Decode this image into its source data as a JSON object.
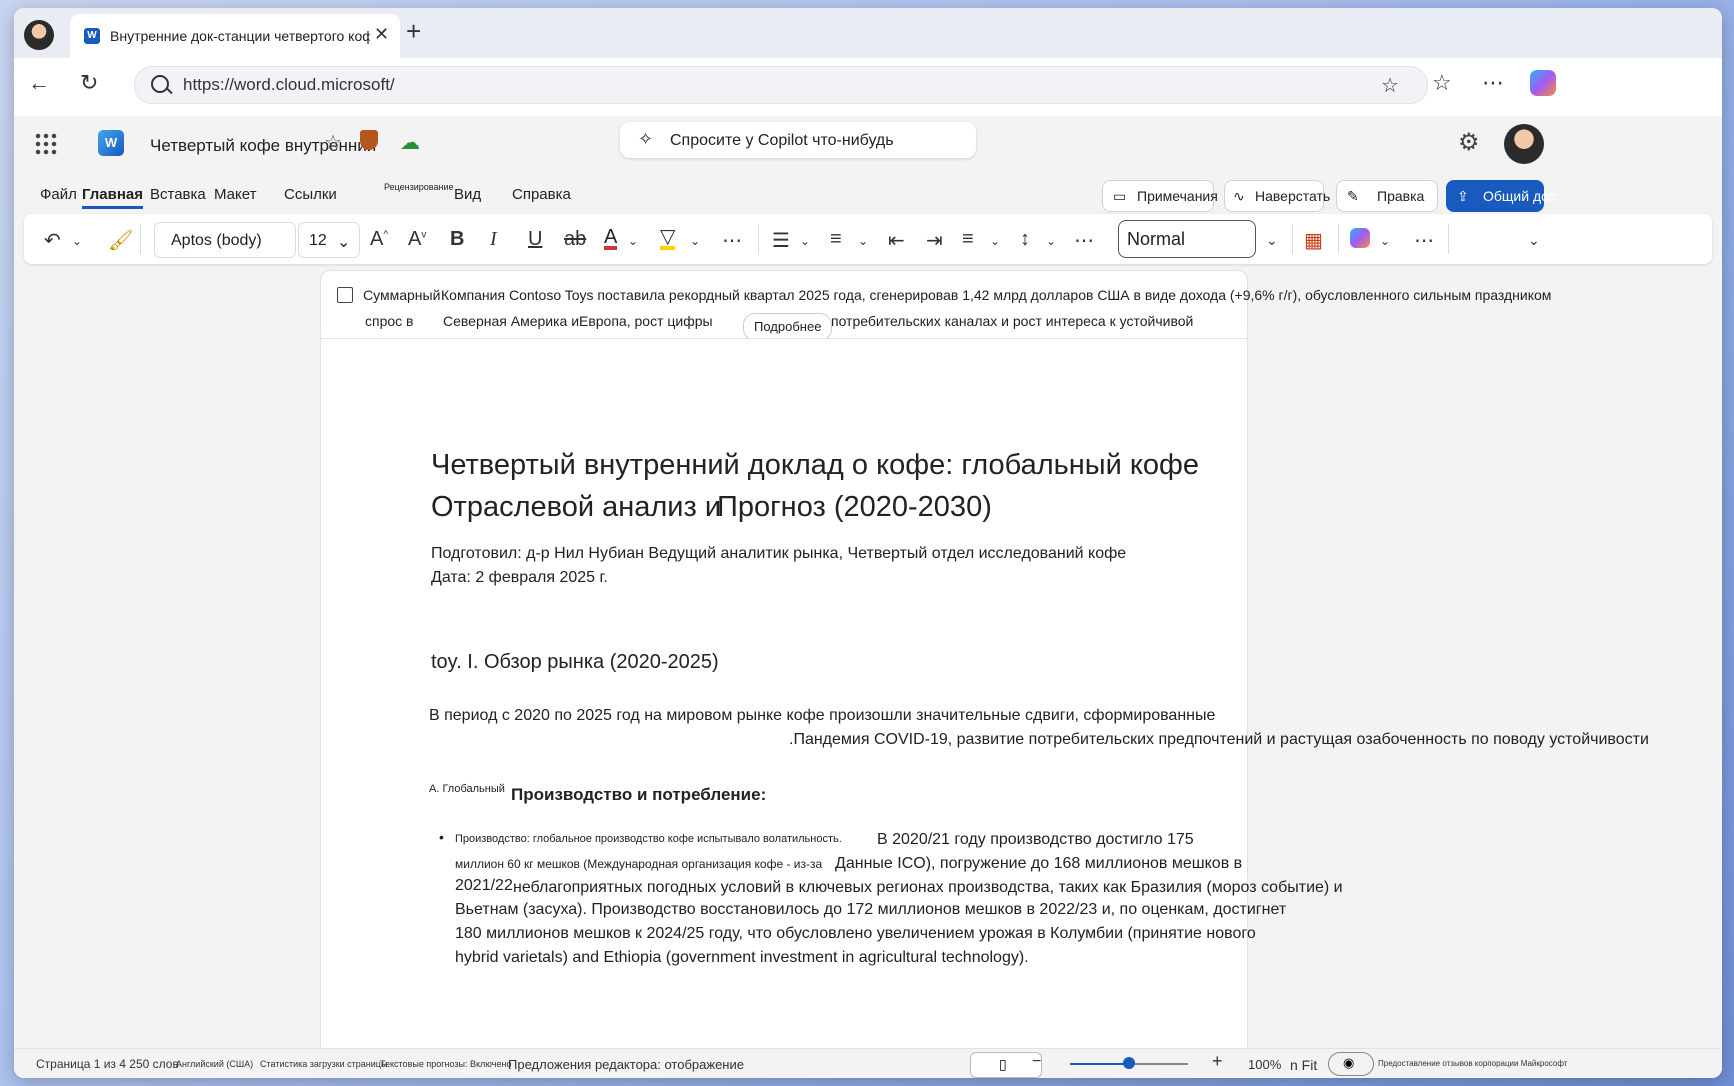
{
  "browser": {
    "tab_title": "Внутренние док-станции четвертого кофе",
    "url": "https://word.cloud.microsoft/"
  },
  "app": {
    "doc_title": "Четвертый кофе внутренний",
    "copilot_placeholder": "Спросите у Copilot что-нибудь"
  },
  "menu": {
    "items": [
      "Файл",
      "Главная",
      "Вставка",
      "Макет",
      "Ссылки",
      "Рецензирование",
      "Вид",
      "Справка"
    ],
    "active": "Главная",
    "comments": "Примечания",
    "catchup": "Наверстать",
    "editing": "Правка",
    "share": "Общий дос"
  },
  "ribbon": {
    "font": "Aptos (body)",
    "size": "12",
    "style": "Normal"
  },
  "summary": {
    "label": "Суммарный",
    "line1": "Компания Contoso Toys поставила рекордный квартал 2025 года, сгенерировав 1,42 млрд долларов США в виде дохода (+9,6% г/г), обусловленного сильным праздником",
    "line2_a": "спрос в",
    "line2_b": "Северная Америка и",
    "line2_c": "Европа, рост цифры",
    "line2_d": "потребительских каналах и рост интереса к устойчивой",
    "more": "Подробнее"
  },
  "document": {
    "title_line1": "Четвертый внутренний доклад о кофе: глобальный кофе",
    "title_line2a": "Отраслевой анализ и",
    "title_line2b": "Прогноз (2020-2030)",
    "prepared": "Подготовил: д-р Нил Нубиан Ведущий аналитик рынка, Четвертый отдел исследований кофе",
    "date": "Дата: 2 февраля 2025 г.",
    "h1": "toy. I. Обзор рынка (2020-2025)",
    "p1a": "В период с 2020 по 2025 год на мировом рынке кофе произошли значительные сдвиги, сформированные",
    "p1b": ".Пандемия COVID-19, развитие потребительских предпочтений и растущая озабоченность по поводу устойчивости",
    "h2a": "А. Глобальный",
    "h2b": "Производство и потребление:",
    "b1a": "Производство: глобальное производство кофе испытывало волатильность.",
    "b1b": "В 2020/21 году производство достигло 175",
    "b1c": "миллион 60 кг мешков (Международная организация кофе - из-за",
    "b1d": "Данные ICO), погружение до 168 миллионов мешков в",
    "b1e": "2021/22",
    "b1f": "неблагоприятных погодных условий в ключевых регионах производства, таких как Бразилия (мороз событие) и",
    "b1g": "Вьетнам (засуха). Производство восстановилось до 172 миллионов мешков в 2022/23 и, по оценкам, достигнет",
    "b1h": "180 миллионов мешков к 2024/25 году, что обусловлено увеличением урожая в Колумбии (принятие нового",
    "b1i": "hybrid varietals) and Ethiopia (government investment in agricultural technology)."
  },
  "status": {
    "page": "Страница 1 из 4 250 слов",
    "lang": "Английский (США)",
    "stats": "Статистика загрузки страницы",
    "predictions": "Текстовые прогнозы: Включено",
    "editor": "Предложения редактора: отображение",
    "zoom": "100%",
    "fit": "n Fit",
    "feedback": "Предоставление отзывов корпорации Майкрософт",
    "zoom_value": 0.5
  }
}
